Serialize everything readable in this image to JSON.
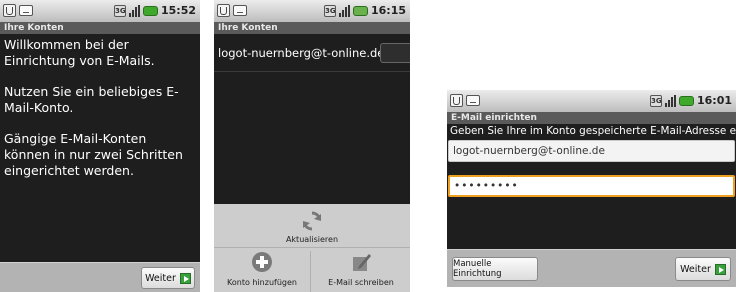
{
  "screen1": {
    "status_time": "15:52",
    "title": "Ihre Konten",
    "paragraphs": [
      "Willkommen bei der Einrichtung von E-Mails.",
      "Nutzen Sie ein beliebiges E-Mail-Konto.",
      "Gängige E-Mail-Konten können in nur zwei Schritten eingerichtet werden."
    ],
    "next_label": "Weiter"
  },
  "screen2": {
    "status_time": "16:15",
    "title": "Ihre Konten",
    "account": "logot-nuernberg@t-online.de",
    "menu": {
      "refresh_label": "Aktualisieren",
      "add_account_label": "Konto hinzufügen",
      "compose_label": "E-Mail schreiben"
    }
  },
  "screen3": {
    "status_time": "16:01",
    "title": "E-Mail einrichten",
    "instruction": "Geben Sie Ihre im Konto gespeicherte E-Mail-Adresse ein:",
    "email_value": "logot-nuernberg@t-online.de",
    "password_value": "•••••••••",
    "manual_label": "Manuelle Einrichtung",
    "next_label": "Weiter"
  },
  "colors": {
    "battery": "#3fa92c",
    "focus": "#f0a020",
    "next_icon": "#39a13b"
  },
  "icons": [
    "usb-icon",
    "mail-icon",
    "network-icon",
    "signal-icon",
    "battery-icon",
    "refresh-icon",
    "add-icon",
    "compose-icon",
    "arrow-right-icon"
  ]
}
